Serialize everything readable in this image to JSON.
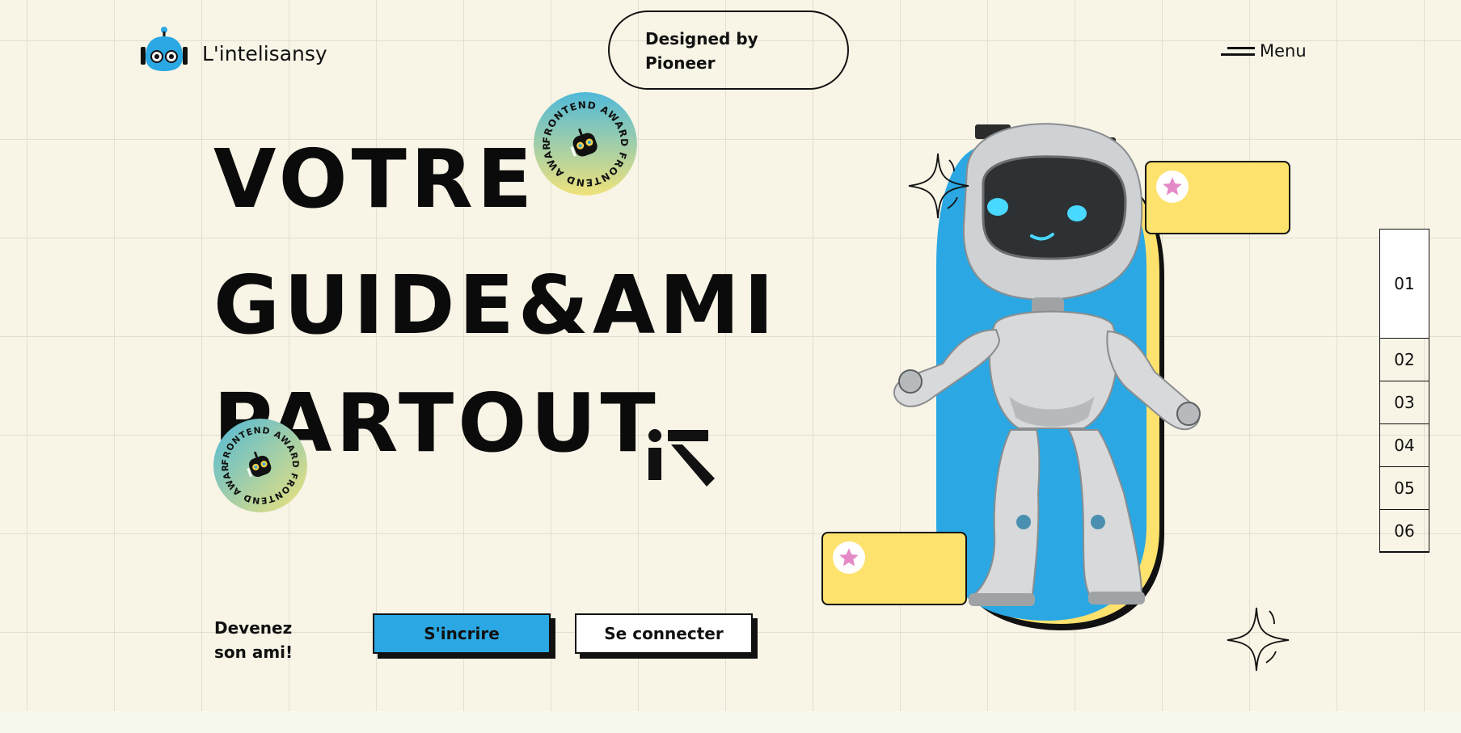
{
  "header": {
    "brand": "L'intelisansy",
    "designed_line1": "Designed by",
    "designed_line2": "Pioneer",
    "menu_label": "Menu"
  },
  "hero": {
    "line1": "VOTRE",
    "line2": "GUIDE&AMI",
    "line3": "PARTOUT"
  },
  "badges": [
    {
      "text": "FRONTEND AWARD FRONTEND AWARD"
    },
    {
      "text": "FRONTEND AWARD FRONTEND AWARD"
    }
  ],
  "cta": {
    "text_line1": "Devenez",
    "text_line2": "son ami!",
    "signup_label": "S'incrire",
    "login_label": "Se connecter"
  },
  "side_nav": {
    "items": [
      "01",
      "02",
      "03",
      "04",
      "05",
      "06"
    ],
    "active": "01"
  },
  "colors": {
    "background": "#f8f4e6",
    "accent_blue": "#2ba8e3",
    "accent_yellow": "#fde26e",
    "star_pink": "#e48bc7",
    "ink": "#111111"
  },
  "icons": [
    "robot-logo-icon",
    "menu-icon",
    "k-logo-icon",
    "sparkle-icon",
    "star-icon",
    "award-badge-icon"
  ]
}
